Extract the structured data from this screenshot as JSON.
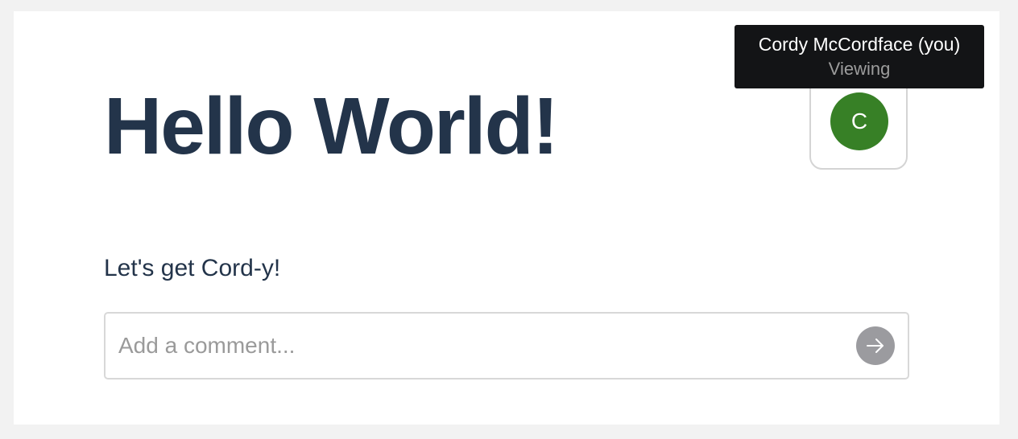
{
  "page": {
    "title": "Hello World!",
    "subtitle": "Let's get Cord-y!"
  },
  "presence": {
    "avatar_initial": "C",
    "avatar_color": "#378026",
    "tooltip": {
      "name": "Cordy McCordface (you)",
      "status": "Viewing"
    }
  },
  "composer": {
    "placeholder": "Add a comment...",
    "value": "",
    "send_icon": "arrow-right-icon",
    "send_button_color": "#9b9b9f"
  },
  "colors": {
    "background": "#f2f2f2",
    "card": "#ffffff",
    "text": "#23344a",
    "tooltip_bg": "#131416"
  }
}
